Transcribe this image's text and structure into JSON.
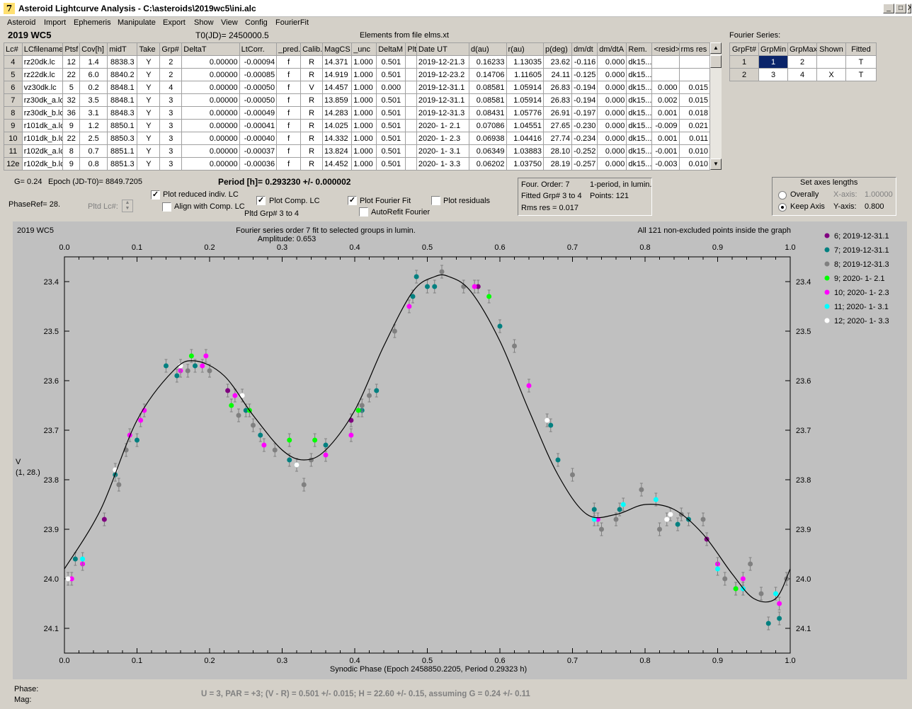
{
  "window": {
    "title": "Asteroid Lightcurve Analysis - C:\\asteroids\\2019wc5\\ini.alc",
    "icon": "app-icon",
    "minimize": "_",
    "maximize": "□",
    "close": "X"
  },
  "menu": [
    "Asteroid",
    "Import",
    "Ephemeris",
    "Manipulate",
    "Export",
    "Show",
    "View",
    "Config",
    "FourierFit"
  ],
  "header": {
    "object": "2019 WC5",
    "t0": "T0(JD)= 2450000.5",
    "elements": "Elements from file elms.xt",
    "fourier_label": "Fourier Series:"
  },
  "lc_table": {
    "columns": [
      "Lc#",
      "LCfilename",
      "Ptsf",
      "Cov[h]",
      "midT",
      "Take",
      "Grp#",
      "DeltaT",
      "LtCorr.",
      "_pred.",
      "Calib.",
      "MagCS",
      "_unc",
      "DeltaM",
      "Plt",
      "Date UT",
      "d(au)",
      "r(au)",
      "p(deg)",
      "dm/dt",
      "dm/dtA",
      "Rem.",
      "<resid>",
      "rms res"
    ],
    "rows": [
      [
        "4",
        "rz20dk.lc",
        "12",
        "1.4",
        "8838.3",
        "Y",
        "2",
        "0.00000",
        "-0.00094",
        "f",
        "R",
        "14.371",
        "1.000",
        "0.501",
        "",
        "2019-12-21.3",
        "0.16233",
        "1.13035",
        "23.62",
        "-0.116",
        "0.000",
        "dk15...",
        "",
        ""
      ],
      [
        "5",
        "rz22dk.lc",
        "22",
        "6.0",
        "8840.2",
        "Y",
        "2",
        "0.00000",
        "-0.00085",
        "f",
        "R",
        "14.919",
        "1.000",
        "0.501",
        "",
        "2019-12-23.2",
        "0.14706",
        "1.11605",
        "24.11",
        "-0.125",
        "0.000",
        "dk15...",
        "",
        ""
      ],
      [
        "6",
        "vz30dk.lc",
        "5",
        "0.2",
        "8848.1",
        "Y",
        "4",
        "0.00000",
        "-0.00050",
        "f",
        "V",
        "14.457",
        "1.000",
        "0.000",
        "",
        "2019-12-31.1",
        "0.08581",
        "1.05914",
        "26.83",
        "-0.194",
        "0.000",
        "dk15...",
        "0.000",
        "0.015"
      ],
      [
        "7",
        "rz30dk_a.lc",
        "32",
        "3.5",
        "8848.1",
        "Y",
        "3",
        "0.00000",
        "-0.00050",
        "f",
        "R",
        "13.859",
        "1.000",
        "0.501",
        "",
        "2019-12-31.1",
        "0.08581",
        "1.05914",
        "26.83",
        "-0.194",
        "0.000",
        "dk15...",
        "0.002",
        "0.015"
      ],
      [
        "8",
        "rz30dk_b.lc",
        "36",
        "3.1",
        "8848.3",
        "Y",
        "3",
        "0.00000",
        "-0.00049",
        "f",
        "R",
        "14.283",
        "1.000",
        "0.501",
        "",
        "2019-12-31.3",
        "0.08431",
        "1.05776",
        "26.91",
        "-0.197",
        "0.000",
        "dk15...",
        "0.001",
        "0.018"
      ],
      [
        "9",
        "r101dk_a.lc",
        "9",
        "1.2",
        "8850.1",
        "Y",
        "3",
        "0.00000",
        "-0.00041",
        "f",
        "R",
        "14.025",
        "1.000",
        "0.501",
        "",
        "2020- 1- 2.1",
        "0.07086",
        "1.04551",
        "27.65",
        "-0.230",
        "0.000",
        "dk15...",
        "-0.009",
        "0.021"
      ],
      [
        "10",
        "r101dk_b.lc",
        "22",
        "2.5",
        "8850.3",
        "Y",
        "3",
        "0.00000",
        "-0.00040",
        "f",
        "R",
        "14.332",
        "1.000",
        "0.501",
        "",
        "2020- 1- 2.3",
        "0.06938",
        "1.04416",
        "27.74",
        "-0.234",
        "0.000",
        "dk15...",
        "0.001",
        "0.011"
      ],
      [
        "11",
        "r102dk_a.lc",
        "8",
        "0.7",
        "8851.1",
        "Y",
        "3",
        "0.00000",
        "-0.00037",
        "f",
        "R",
        "13.824",
        "1.000",
        "0.501",
        "",
        "2020- 1- 3.1",
        "0.06349",
        "1.03883",
        "28.10",
        "-0.252",
        "0.000",
        "dk15...",
        "-0.001",
        "0.010"
      ],
      [
        "12e",
        "r102dk_b.lc",
        "9",
        "0.8",
        "8851.3",
        "Y",
        "3",
        "0.00000",
        "-0.00036",
        "f",
        "R",
        "14.452",
        "1.000",
        "0.501",
        "",
        "2020- 1- 3.3",
        "0.06202",
        "1.03750",
        "28.19",
        "-0.257",
        "0.000",
        "dk15...",
        "-0.003",
        "0.010"
      ]
    ]
  },
  "fourier_table": {
    "columns": [
      "GrpFt#",
      "GrpMin",
      "GrpMax",
      "Shown",
      "Fitted"
    ],
    "rows": [
      [
        "1",
        "1",
        "2",
        "",
        "T"
      ],
      [
        "2",
        "3",
        "4",
        "X",
        "T"
      ]
    ]
  },
  "controls": {
    "g": "G= 0.24",
    "epoch": "Epoch (JD-T0)= 8849.7205",
    "period": "Period [h]= 0.293230 +/- 0.000002",
    "phaseref": "PhaseRef= 28.",
    "pltd_lc": "Pltd Lc#:",
    "plot_reduced": "Plot reduced indiv. LC",
    "align_comp": "Align with Comp. LC",
    "plot_comp": "Plot Comp. LC",
    "pltd_grp": "Pltd Grp#  3   to   4",
    "plot_fourier": "Plot Fourier Fit",
    "autorefit": "AutoRefit Fourier",
    "plot_residuals": "Plot residuals",
    "info_order": "Four. Order:  7",
    "info_period": "1-period, in lumin.",
    "info_fitted": "Fitted Grp# 3 to 4",
    "info_points": "Points: 121",
    "info_rms": "Rms res      = 0.017",
    "axes_title": "Set axes lengths",
    "overally": "Overally",
    "keep_axis": "Keep Axis",
    "xaxis_label": "X-axis:",
    "xaxis_value": "1.00000",
    "yaxis_label": "Y-axis:",
    "yaxis_value": "0.800",
    "checks": {
      "plot_reduced": true,
      "align_comp": false,
      "plot_comp": true,
      "plot_fourier": true,
      "autorefit": false,
      "plot_residuals": false
    },
    "radio_selected": "keep_axis"
  },
  "chart_labels": {
    "object": "2019 WC5",
    "fit_desc": "Fourier series order 7 fit to selected groups in lumin.",
    "amplitude": "Amplitude: 0.653",
    "points_note": "All 121 non-excluded points inside the graph",
    "ylabel": "V",
    "ylabel_sub": "(1, 28.)",
    "xlabel": "Synodic Phase (Epoch 2458850.2205, Period 0.29323 h)"
  },
  "footer": {
    "phase": "Phase:",
    "mag": "Mag:",
    "summary": "U = 3, PAR = +3; (V - R) = 0.501 +/- 0.015; H = 22.60 +/- 0.15, assuming G = 0.24 +/- 0.11"
  },
  "chart_data": {
    "type": "scatter",
    "xlim": [
      0,
      1
    ],
    "ylim": [
      24.15,
      23.35
    ],
    "y_inverted": true,
    "xticks": [
      "0.0",
      "0.1",
      "0.2",
      "0.3",
      "0.4",
      "0.5",
      "0.6",
      "0.7",
      "0.8",
      "0.9",
      "1.0"
    ],
    "yticks": [
      "23.4",
      "23.5",
      "23.6",
      "23.7",
      "23.8",
      "23.9",
      "24.0",
      "24.1"
    ],
    "ytick_values": [
      23.4,
      23.5,
      23.6,
      23.7,
      23.8,
      23.9,
      24.0,
      24.1
    ],
    "series": [
      {
        "name": "6; 2019-12-31.1",
        "color": "#800080",
        "points": [
          [
            0.055,
            23.88
          ],
          [
            0.225,
            23.62
          ],
          [
            0.395,
            23.68
          ],
          [
            0.57,
            23.41
          ],
          [
            0.885,
            23.92
          ]
        ]
      },
      {
        "name": "7; 2019-12-31.1",
        "color": "#008080",
        "points": [
          [
            0.015,
            23.96
          ],
          [
            0.07,
            23.79
          ],
          [
            0.1,
            23.72
          ],
          [
            0.14,
            23.57
          ],
          [
            0.155,
            23.59
          ],
          [
            0.18,
            23.57
          ],
          [
            0.25,
            23.66
          ],
          [
            0.27,
            23.71
          ],
          [
            0.31,
            23.76
          ],
          [
            0.32,
            23.77
          ],
          [
            0.36,
            23.73
          ],
          [
            0.41,
            23.66
          ],
          [
            0.43,
            23.62
          ],
          [
            0.48,
            23.43
          ],
          [
            0.485,
            23.39
          ],
          [
            0.5,
            23.41
          ],
          [
            0.51,
            23.41
          ],
          [
            0.6,
            23.49
          ],
          [
            0.67,
            23.69
          ],
          [
            0.68,
            23.76
          ],
          [
            0.73,
            23.86
          ],
          [
            0.765,
            23.86
          ],
          [
            0.845,
            23.89
          ],
          [
            0.86,
            23.88
          ],
          [
            0.935,
            24.02
          ],
          [
            0.97,
            24.09
          ],
          [
            0.985,
            24.08
          ]
        ]
      },
      {
        "name": "8; 2019-12-31.3",
        "color": "#808080",
        "points": [
          [
            0.075,
            23.81
          ],
          [
            0.085,
            23.74
          ],
          [
            0.17,
            23.58
          ],
          [
            0.2,
            23.58
          ],
          [
            0.24,
            23.67
          ],
          [
            0.26,
            23.69
          ],
          [
            0.29,
            23.74
          ],
          [
            0.33,
            23.81
          ],
          [
            0.34,
            23.76
          ],
          [
            0.41,
            23.65
          ],
          [
            0.42,
            23.63
          ],
          [
            0.455,
            23.5
          ],
          [
            0.52,
            23.38
          ],
          [
            0.55,
            23.41
          ],
          [
            0.62,
            23.53
          ],
          [
            0.665,
            23.68
          ],
          [
            0.7,
            23.79
          ],
          [
            0.74,
            23.9
          ],
          [
            0.76,
            23.88
          ],
          [
            0.795,
            23.82
          ],
          [
            0.82,
            23.9
          ],
          [
            0.85,
            23.87
          ],
          [
            0.88,
            23.88
          ],
          [
            0.91,
            24.0
          ],
          [
            0.925,
            24.02
          ],
          [
            0.945,
            23.97
          ],
          [
            0.96,
            24.03
          ],
          [
            0.995,
            24.0
          ]
        ]
      },
      {
        "name": "9; 2020- 1- 2.1",
        "color": "#00ff00",
        "points": [
          [
            0.175,
            23.55
          ],
          [
            0.23,
            23.65
          ],
          [
            0.255,
            23.66
          ],
          [
            0.31,
            23.72
          ],
          [
            0.345,
            23.72
          ],
          [
            0.405,
            23.66
          ],
          [
            0.585,
            23.43
          ],
          [
            0.925,
            24.02
          ]
        ]
      },
      {
        "name": "10; 2020- 1- 2.3",
        "color": "#ff00ff",
        "points": [
          [
            0.01,
            24.0
          ],
          [
            0.025,
            23.97
          ],
          [
            0.09,
            23.71
          ],
          [
            0.105,
            23.68
          ],
          [
            0.11,
            23.66
          ],
          [
            0.16,
            23.58
          ],
          [
            0.19,
            23.57
          ],
          [
            0.195,
            23.55
          ],
          [
            0.235,
            23.63
          ],
          [
            0.275,
            23.73
          ],
          [
            0.36,
            23.75
          ],
          [
            0.395,
            23.71
          ],
          [
            0.475,
            23.45
          ],
          [
            0.565,
            23.41
          ],
          [
            0.64,
            23.61
          ],
          [
            0.735,
            23.88
          ],
          [
            0.9,
            23.97
          ],
          [
            0.935,
            24.0
          ],
          [
            0.985,
            24.05
          ]
        ]
      },
      {
        "name": "11; 2020- 1- 3.1",
        "color": "#00ffff",
        "points": [
          [
            0.025,
            23.96
          ],
          [
            0.73,
            23.88
          ],
          [
            0.77,
            23.85
          ],
          [
            0.815,
            23.84
          ],
          [
            0.9,
            23.98
          ],
          [
            0.935,
            24.02
          ],
          [
            0.98,
            24.03
          ]
        ]
      },
      {
        "name": "12; 2020- 1- 3.3",
        "color": "#ffffff",
        "points": [
          [
            0.005,
            24.0
          ],
          [
            0.07,
            23.78
          ],
          [
            0.16,
            23.57
          ],
          [
            0.245,
            23.63
          ],
          [
            0.32,
            23.77
          ],
          [
            0.665,
            23.68
          ],
          [
            0.83,
            23.88
          ],
          [
            0.835,
            23.87
          ]
        ]
      }
    ],
    "fit": {
      "name": "Fourier Fit",
      "color": "#000000",
      "x": [
        0.0,
        0.05,
        0.1,
        0.15,
        0.18,
        0.22,
        0.26,
        0.3,
        0.33,
        0.36,
        0.4,
        0.44,
        0.48,
        0.51,
        0.53,
        0.56,
        0.6,
        0.64,
        0.68,
        0.72,
        0.76,
        0.8,
        0.84,
        0.88,
        0.92,
        0.95,
        0.98,
        1.0
      ],
      "y": [
        23.98,
        23.86,
        23.68,
        23.58,
        23.56,
        23.59,
        23.67,
        23.74,
        23.76,
        23.74,
        23.66,
        23.53,
        23.42,
        23.39,
        23.39,
        23.42,
        23.52,
        23.66,
        23.79,
        23.87,
        23.87,
        23.85,
        23.86,
        23.91,
        23.99,
        24.04,
        24.04,
        23.98
      ]
    },
    "legend_position": "right",
    "grid": false
  }
}
